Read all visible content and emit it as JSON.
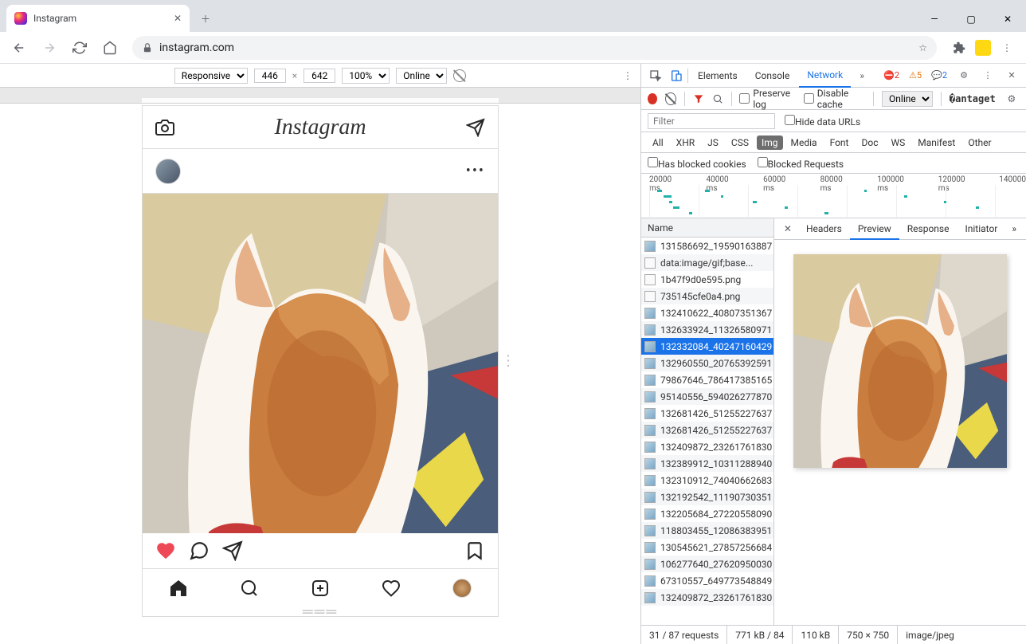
{
  "browser": {
    "tab_title": "Instagram",
    "url": "instagram.com",
    "win_min": "—",
    "win_max": "▢",
    "win_close": "✕"
  },
  "device_toolbar": {
    "device": "Responsive",
    "width": "446",
    "height": "642",
    "zoom": "100%",
    "throttle": "Online"
  },
  "instagram": {
    "logo": "Instagram"
  },
  "devtools": {
    "tabs": {
      "elements": "Elements",
      "console": "Console",
      "network": "Network"
    },
    "errors": "2",
    "warnings": "5",
    "messages": "2",
    "preserve_log": "Preserve log",
    "disable_cache": "Disable cache",
    "throttle": "Online",
    "filter_placeholder": "Filter",
    "hide_data_urls": "Hide data URLs",
    "type_filters": [
      "All",
      "XHR",
      "JS",
      "CSS",
      "Img",
      "Media",
      "Font",
      "Doc",
      "WS",
      "Manifest",
      "Other"
    ],
    "blocked_cookies": "Has blocked cookies",
    "blocked_requests": "Blocked Requests",
    "waterfall_labels": [
      "20000 ms",
      "40000 ms",
      "60000 ms",
      "80000 ms",
      "100000 ms",
      "120000 ms",
      "140000"
    ],
    "name_header": "Name",
    "requests": [
      {
        "name": "131586692_19590163887",
        "type": "img"
      },
      {
        "name": "data:image/gif;base...",
        "type": "gif"
      },
      {
        "name": "1b47f9d0e595.png",
        "type": "gif"
      },
      {
        "name": "735145cfe0a4.png",
        "type": "gif"
      },
      {
        "name": "132410622_40807351367",
        "type": "img"
      },
      {
        "name": "132633924_11326580971",
        "type": "img"
      },
      {
        "name": "132332084_40247160429",
        "type": "img",
        "selected": true
      },
      {
        "name": "132960550_20765392591",
        "type": "img"
      },
      {
        "name": "79867646_786417385165",
        "type": "img"
      },
      {
        "name": "95140556_594026277870",
        "type": "img"
      },
      {
        "name": "132681426_51255227637",
        "type": "img"
      },
      {
        "name": "132681426_51255227637",
        "type": "img"
      },
      {
        "name": "132409872_23261761830",
        "type": "img"
      },
      {
        "name": "132389912_10311288940",
        "type": "img"
      },
      {
        "name": "132310912_74040662683",
        "type": "img"
      },
      {
        "name": "132192542_11190730351",
        "type": "img"
      },
      {
        "name": "132205684_27220558090",
        "type": "img"
      },
      {
        "name": "118803455_12086383951",
        "type": "img"
      },
      {
        "name": "130545621_27857256684",
        "type": "img"
      },
      {
        "name": "106277640_27620950030",
        "type": "img"
      },
      {
        "name": "67310557_649773548849",
        "type": "img"
      },
      {
        "name": "132409872_23261761830",
        "type": "img"
      }
    ],
    "detail_tabs": {
      "headers": "Headers",
      "preview": "Preview",
      "response": "Response",
      "initiator": "Initiator"
    },
    "status": {
      "requests": "31 / 87 requests",
      "transfer": "771 kB / 84",
      "resources": "110 kB",
      "dimensions": "750 × 750",
      "mime": "image/jpeg"
    }
  }
}
